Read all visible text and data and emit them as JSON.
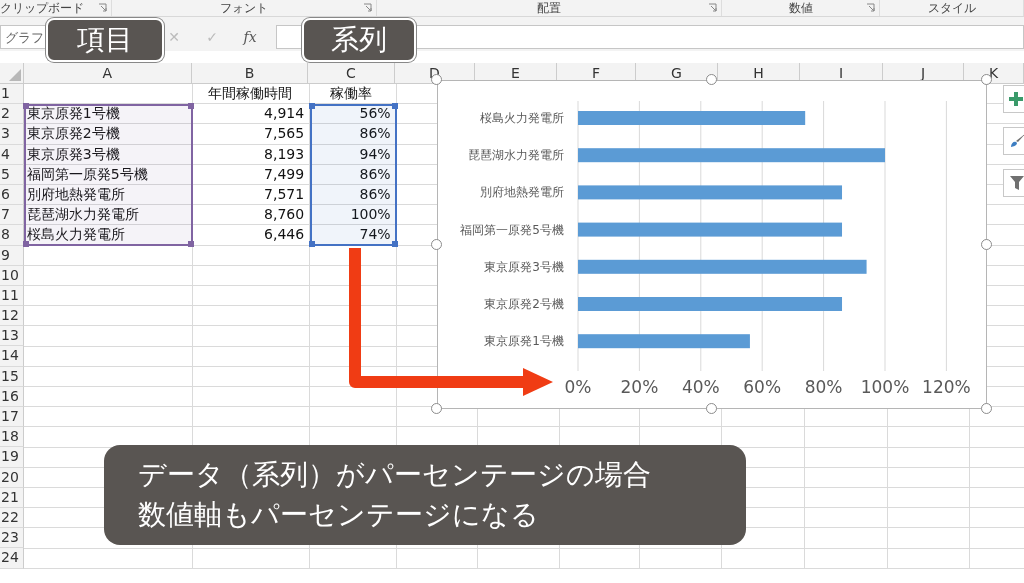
{
  "ribbon_groups": [
    {
      "label": "クリップボード"
    },
    {
      "label": "フォント"
    },
    {
      "label": "配置"
    },
    {
      "label": "数値"
    },
    {
      "label": "スタイル"
    }
  ],
  "formula_bar": {
    "name_box": "グラフ",
    "cancel": "✕",
    "enter": "✓",
    "function": "fx"
  },
  "callouts": [
    {
      "text": "項目"
    },
    {
      "text": "系列"
    }
  ],
  "columns": [
    {
      "label": "A",
      "color": "#8064a2"
    },
    {
      "label": "B"
    },
    {
      "label": "C",
      "color": "#4472c4"
    },
    {
      "label": "D"
    },
    {
      "label": "E"
    },
    {
      "label": "F"
    },
    {
      "label": "G"
    },
    {
      "label": "H"
    },
    {
      "label": "I"
    },
    {
      "label": "J"
    },
    {
      "label": "K"
    }
  ],
  "rows": [
    {
      "number": "1",
      "b": "年間稼働時間",
      "c": "稼働率"
    },
    {
      "number": "2",
      "a": "東京原発1号機",
      "b": "4,914",
      "c": "56%"
    },
    {
      "number": "3",
      "a": "東京原発2号機",
      "b": "7,565",
      "c": "86%"
    },
    {
      "number": "4",
      "a": "東京原発3号機",
      "b": "8,193",
      "c": "94%"
    },
    {
      "number": "5",
      "a": "福岡第一原発5号機",
      "b": "7,499",
      "c": "86%"
    },
    {
      "number": "6",
      "a": "別府地熱発電所",
      "b": "7,571",
      "c": "86%"
    },
    {
      "number": "7",
      "a": "琵琶湖水力発電所",
      "b": "8,760",
      "c": "100%"
    },
    {
      "number": "8",
      "a": "桜島火力発電所",
      "b": "6,446",
      "c": "74%"
    },
    {
      "number": "9"
    },
    {
      "number": "10"
    },
    {
      "number": "11"
    },
    {
      "number": "12"
    },
    {
      "number": "13"
    },
    {
      "number": "14"
    },
    {
      "number": "15"
    },
    {
      "number": "16"
    },
    {
      "number": "17"
    },
    {
      "number": "18"
    },
    {
      "number": "19"
    },
    {
      "number": "20"
    },
    {
      "number": "21"
    },
    {
      "number": "22"
    },
    {
      "number": "23"
    },
    {
      "number": "24"
    }
  ],
  "chart": {
    "chart_data": {
      "type": "bar",
      "orientation": "horizontal",
      "grid": true,
      "categories": [
        "桜島火力発電所",
        "琵琶湖水力発電所",
        "別府地熱発電所",
        "福岡第一原発5号機",
        "東京原発3号機",
        "東京原発2号機",
        "東京原発1号機"
      ],
      "series": [
        {
          "color": "#5b9bd5",
          "values": [
            0.74,
            1.0,
            0.86,
            0.86,
            0.94,
            0.86,
            0.56
          ]
        }
      ],
      "xlim": [
        0,
        1.2
      ],
      "xticks": [
        {
          "value": 0,
          "label": "0%"
        },
        {
          "value": 0.2,
          "label": "20%"
        },
        {
          "value": 0.4,
          "label": "40%"
        },
        {
          "value": 0.6,
          "label": "60%"
        },
        {
          "value": 0.8,
          "label": "80%"
        },
        {
          "value": 1.0,
          "label": "100%"
        },
        {
          "value": 1.2,
          "label": "120%"
        }
      ]
    }
  },
  "caption": [
    "データ（系列）がパーセンテージの場合",
    "数値軸もパーセンテージになる"
  ]
}
